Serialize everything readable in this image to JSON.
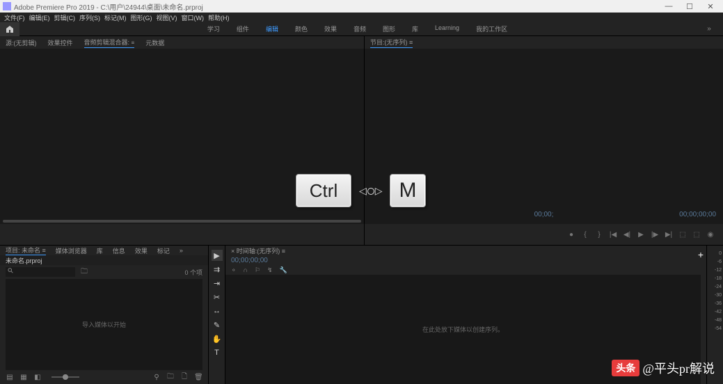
{
  "title_bar": {
    "title": "Adobe Premiere Pro 2019 - C:\\用户\\24944\\桌面\\未命名.prproj"
  },
  "menu": [
    "文件(F)",
    "编辑(E)",
    "剪辑(C)",
    "序列(S)",
    "标记(M)",
    "图形(G)",
    "视图(V)",
    "窗口(W)",
    "帮助(H)"
  ],
  "workspaces": {
    "items": [
      "学习",
      "组件",
      "编辑",
      "颜色",
      "效果",
      "音频",
      "图形",
      "库",
      "Learning",
      "我的工作区"
    ],
    "active_index": 2
  },
  "source_panel": {
    "tabs": [
      "源:(无剪辑)",
      "效果控件",
      "音频剪辑混合器:",
      "元数据"
    ],
    "active_index": 2
  },
  "program_panel": {
    "title": "节目:(无序列) ≡",
    "timecode_center": "00;00;",
    "timecode_right": "00;00;00;00"
  },
  "project_panel": {
    "tabs": [
      "项目: 未命名 ≡",
      "媒体浏览器",
      "库",
      "信息",
      "效果",
      "标记",
      "»"
    ],
    "file_header": "未命名.prproj",
    "search_placeholder": "",
    "item_count": "0 个项",
    "empty_text": "导入媒体以开始"
  },
  "timeline_panel": {
    "header": "× 时间轴:(无序列) ≡",
    "timecode": "00;00;00;00",
    "empty_text": "在此处放下媒体以创建序列。"
  },
  "audio_meter": {
    "ticks": [
      "0",
      "-6",
      "-12",
      "-18",
      "-24",
      "-30",
      "-36",
      "-42",
      "-48",
      "-54"
    ]
  },
  "keycaps": {
    "ctrl": "Ctrl",
    "m": "M"
  },
  "watermark": {
    "badge": "头条",
    "text": "@平头pr解说"
  }
}
